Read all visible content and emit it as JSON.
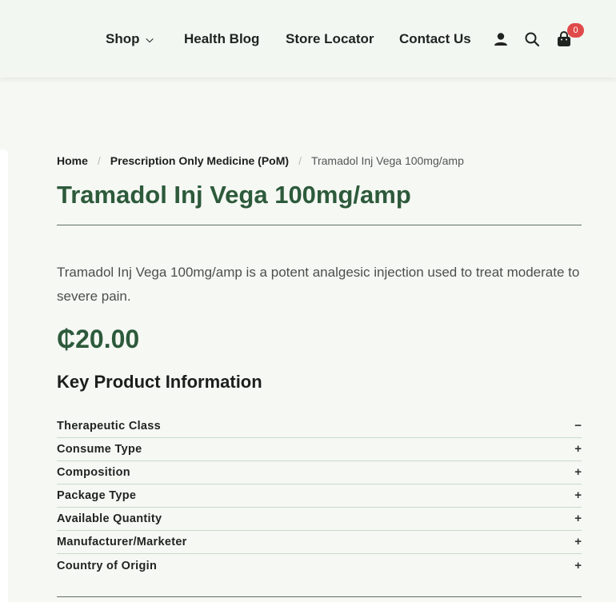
{
  "header": {
    "nav": {
      "shop": "Shop",
      "health_blog": "Health Blog",
      "store_locator": "Store Locator",
      "contact_us": "Contact Us"
    },
    "icons": [
      "user-icon",
      "search-icon",
      "cart-icon"
    ],
    "cart_count": "0"
  },
  "breadcrumb": {
    "home": "Home",
    "category": "Prescription Only Medicine (PoM)",
    "current": "Tramadol Inj Vega 100mg/amp"
  },
  "product": {
    "title": "Tramadol Inj Vega 100mg/amp",
    "description": "Tramadol Inj Vega 100mg/amp is a potent analgesic injection used to treat moderate to severe pain.",
    "price": "₵20.00"
  },
  "key_info": {
    "heading": "Key Product Information",
    "items": [
      {
        "label": "Therapeutic Class",
        "toggle": "−"
      },
      {
        "label": "Consume Type",
        "toggle": "+"
      },
      {
        "label": "Composition",
        "toggle": "+"
      },
      {
        "label": "Package Type",
        "toggle": "+"
      },
      {
        "label": "Available Quantity",
        "toggle": "+"
      },
      {
        "label": "Manufacturer/Marketer",
        "toggle": "+"
      },
      {
        "label": "Country of Origin",
        "toggle": "+"
      }
    ]
  },
  "colors": {
    "brand_green": "#2d5a3b",
    "badge_red": "#e04a4a",
    "header_bg": "#f2f7f2",
    "page_bg": "#f6f8f4"
  }
}
